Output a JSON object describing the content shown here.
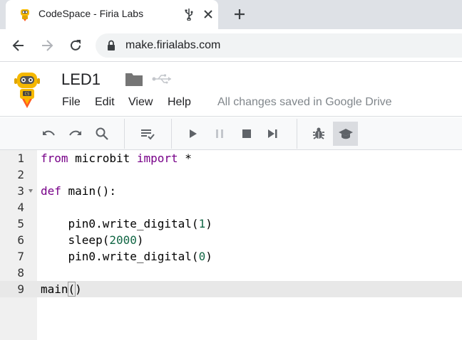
{
  "browser": {
    "tab_title": "CodeSpace - Firia Labs",
    "url": "make.firialabs.com"
  },
  "app": {
    "file_name": "LED1",
    "menu": [
      "File",
      "Edit",
      "View",
      "Help"
    ],
    "save_status": "All changes saved in Google Drive"
  },
  "toolbar": {
    "icons": [
      "undo-icon",
      "redo-icon",
      "search-icon",
      "check-list-icon",
      "run-icon",
      "pause-icon",
      "stop-icon",
      "step-icon",
      "debug-icon",
      "learn-icon"
    ]
  },
  "editor": {
    "line_numbers": [
      "1",
      "2",
      "3",
      "4",
      "5",
      "6",
      "7",
      "8",
      "9"
    ],
    "lines": [
      {
        "p1": "from",
        "p2": " microbit ",
        "p3": "import",
        "p4": " *"
      },
      {
        "p1": ""
      },
      {
        "p1": "def",
        "p2": " main",
        "p3": "():"
      },
      {
        "p1": ""
      },
      {
        "p1": "    pin0.write_digital(",
        "p2": "1",
        "p3": ")"
      },
      {
        "p1": "    sleep(",
        "p2": "2000",
        "p3": ")"
      },
      {
        "p1": "    pin0.write_digital(",
        "p2": "0",
        "p3": ")"
      },
      {
        "p1": ""
      },
      {
        "p1": "main",
        "p2": "(",
        "p3": ")"
      }
    ]
  },
  "colors": {
    "keyword": "#770088",
    "number": "#116644",
    "active_toolbar_bg": "#dadce0"
  }
}
